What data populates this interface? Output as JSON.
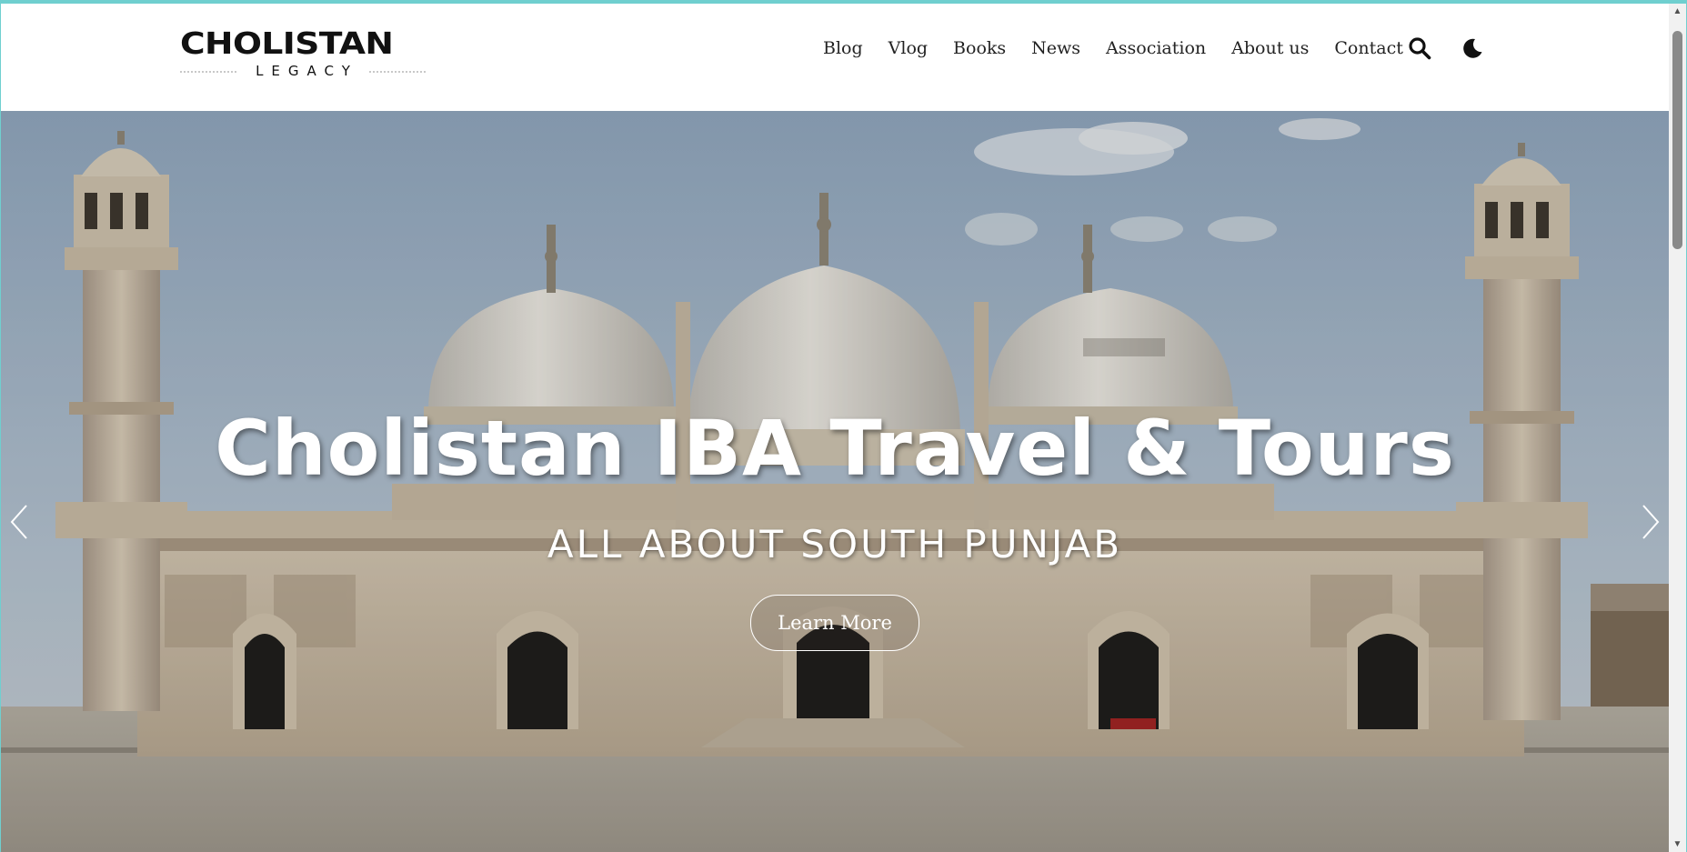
{
  "brand": {
    "name": "CHOLISTAN",
    "tagline": "LEGACY"
  },
  "nav": {
    "items": [
      {
        "label": "Blog"
      },
      {
        "label": "Vlog"
      },
      {
        "label": "Books"
      },
      {
        "label": "News"
      },
      {
        "label": "Association"
      },
      {
        "label": "About us"
      },
      {
        "label": "Contact"
      }
    ],
    "search_icon": "search-icon",
    "theme_icon": "moon-icon"
  },
  "hero": {
    "title": "Cholistan IBA Travel & Tours",
    "subtitle": "ALL ABOUT SOUTH PUNJAB",
    "cta_label": "Learn More",
    "prev_icon": "chevron-left-icon",
    "next_icon": "chevron-right-icon"
  },
  "colors": {
    "accent_border": "#6fcfcf",
    "nav_text": "#222222",
    "hero_text": "#ffffff"
  }
}
